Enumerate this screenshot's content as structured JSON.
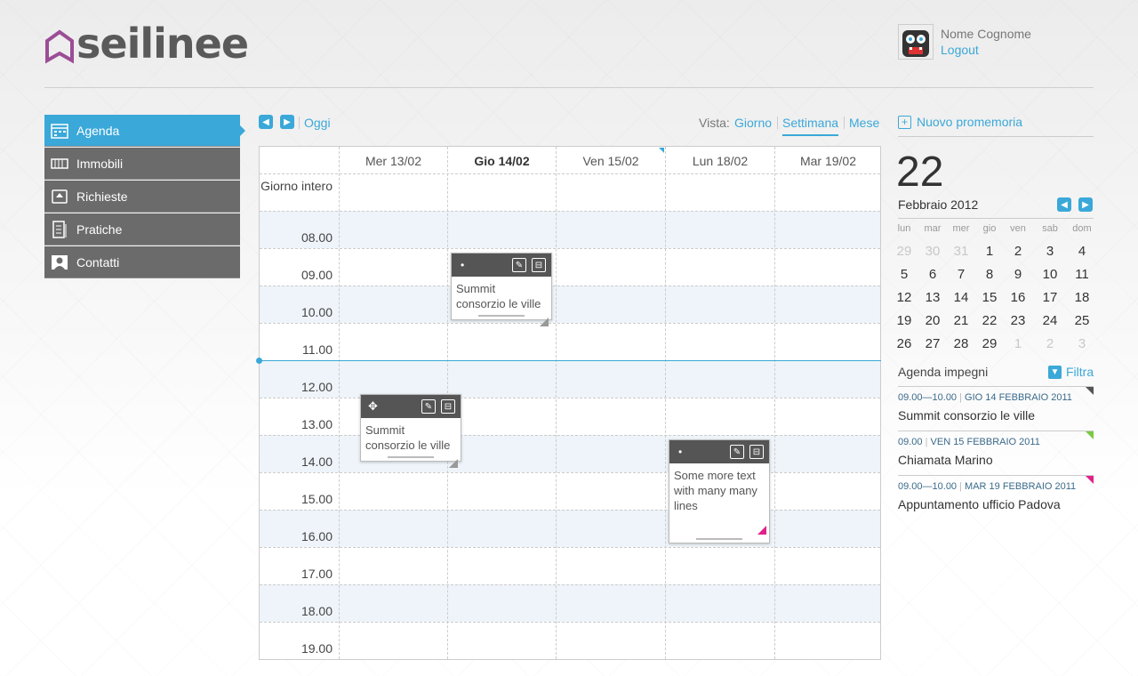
{
  "header": {
    "logo_text": "seilinee",
    "user_name": "Nome Cognome",
    "logout_label": "Logout"
  },
  "sidebar": {
    "items": [
      {
        "label": "Agenda",
        "icon": "calendar-icon",
        "active": true
      },
      {
        "label": "Immobili",
        "icon": "building-icon",
        "active": false
      },
      {
        "label": "Richieste",
        "icon": "inbox-icon",
        "active": false
      },
      {
        "label": "Pratiche",
        "icon": "document-icon",
        "active": false
      },
      {
        "label": "Contatti",
        "icon": "contact-icon",
        "active": false
      }
    ]
  },
  "calendar_nav": {
    "today_label": "Oggi",
    "view_label": "Vista:",
    "views": [
      "Giorno",
      "Settimana",
      "Mese"
    ],
    "active_view": "Settimana"
  },
  "week": {
    "days": [
      "Mer 13/02",
      "Gio 14/02",
      "Ven 15/02",
      "Lun 18/02",
      "Mar 19/02"
    ],
    "today_day": "Gio 14/02",
    "all_day_label": "Giorno intero",
    "hours": [
      "08.00",
      "09.00",
      "10.00",
      "11.00",
      "12.00",
      "13.00",
      "14.00",
      "15.00",
      "16.00",
      "17.00",
      "18.00",
      "19.00"
    ]
  },
  "events": [
    {
      "text": "Summit consorzio le ville",
      "day": "Gio 14/02"
    },
    {
      "text": "Summit consorzio le ville",
      "day": "Mer 13/02",
      "dragging": true
    },
    {
      "text": "Some more text with many many lines",
      "day": "Lun 18/02"
    }
  ],
  "right_panel": {
    "new_reminder_label": "Nuovo promemoria",
    "big_day": "22",
    "month_year": "Febbraio 2012",
    "weekdays": [
      "lun",
      "mar",
      "mer",
      "gio",
      "ven",
      "sab",
      "dom"
    ],
    "weeks": [
      [
        "29",
        "30",
        "31",
        "1",
        "2",
        "3",
        "4"
      ],
      [
        "5",
        "6",
        "7",
        "8",
        "9",
        "10",
        "11"
      ],
      [
        "12",
        "13",
        "14",
        "15",
        "16",
        "17",
        "18"
      ],
      [
        "19",
        "20",
        "21",
        "22",
        "23",
        "24",
        "25"
      ],
      [
        "26",
        "27",
        "28",
        "29",
        "1",
        "2",
        "3"
      ]
    ],
    "agenda_title": "Agenda impegni",
    "filter_label": "Filtra",
    "agenda_items": [
      {
        "time": "09.00—10.00",
        "date": "GIO 14 FEBBRAIO 2011",
        "title": "Summit consorzio le ville",
        "color": "#555555"
      },
      {
        "time": "09.00",
        "date": "VEN 15 FEBBRAIO 2011",
        "title": "Chiamata Marino",
        "color": "#7ac943"
      },
      {
        "time": "09.00—10.00",
        "date": "MAR 19 FEBBRAIO 2011",
        "title": "Appuntamento ufficio Padova",
        "color": "#e0218a"
      }
    ]
  },
  "colors": {
    "accent": "#3aa8d8",
    "sidebar": "#6b6b6b"
  }
}
